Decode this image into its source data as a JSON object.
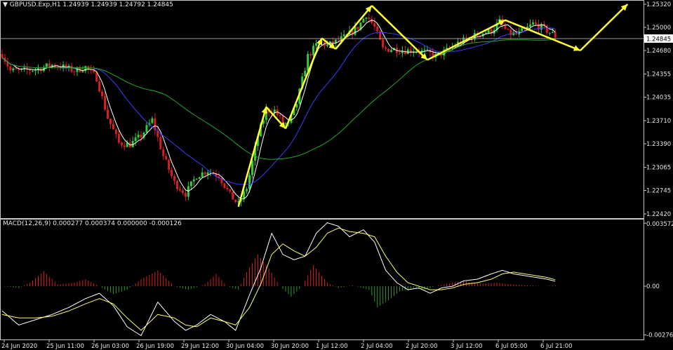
{
  "colors": {
    "background": "#000000",
    "bull_candle": "#2ecc40",
    "bear_candle": "#d62020",
    "ma_fast": "#ffffff",
    "ma_mid": "#3b3bff",
    "ma_slow": "#24a824",
    "arrows": "#ffff33",
    "macd_pos": "#d62020",
    "macd_neg": "#2a9a2a",
    "signal": "#ffff66",
    "grid_frame": "#c8c8c8"
  },
  "header": {
    "instrument": "GBPUSD.Exp,H1",
    "ohlc": "1.24939 1.24939 1.24792 1.24845"
  },
  "macd_header": {
    "label": "MACD(12,26,9) 0.000277 0.000374 0.000000 -0.000126"
  },
  "current_price_label": "1.24845",
  "chart_data": [
    {
      "type": "candlestick",
      "title": "GBPUSD.Exp,H1",
      "ylim": [
        1.2242,
        1.2532
      ],
      "y_ticks": [
        "1.25320",
        "1.25000",
        "1.24680",
        "1.24355",
        "1.24035",
        "1.23710",
        "1.23390",
        "1.23065",
        "1.22745",
        "1.22420"
      ],
      "current_price": 1.24845,
      "x_ticks": [
        "24 Jun 2020",
        "25 Jun 11:00",
        "26 Jun 03:00",
        "26 Jun 19:00",
        "29 Jun 12:00",
        "30 Jun 04:00",
        "30 Jun 20:00",
        "1 Jul 12:00",
        "2 Jul 04:00",
        "2 Jul 20:00",
        "3 Jul 12:00",
        "6 Jul 05:00",
        "6 Jul 21:00"
      ],
      "price_path_keypoints": [
        [
          0,
          1.2463
        ],
        [
          3,
          1.244
        ],
        [
          8,
          1.244
        ],
        [
          13,
          1.2443
        ],
        [
          18,
          1.2448
        ],
        [
          22,
          1.2445
        ],
        [
          26,
          1.244
        ],
        [
          30,
          1.2445
        ],
        [
          34,
          1.243
        ],
        [
          38,
          1.2375
        ],
        [
          42,
          1.234
        ],
        [
          46,
          1.2338
        ],
        [
          50,
          1.235
        ],
        [
          54,
          1.2372
        ],
        [
          58,
          1.2322
        ],
        [
          62,
          1.2285
        ],
        [
          66,
          1.227
        ],
        [
          70,
          1.2295
        ],
        [
          74,
          1.2302
        ],
        [
          78,
          1.2295
        ],
        [
          82,
          1.2268
        ],
        [
          85,
          1.2255
        ],
        [
          88,
          1.2278
        ],
        [
          92,
          1.235
        ],
        [
          95,
          1.2385
        ],
        [
          98,
          1.2385
        ],
        [
          101,
          1.2368
        ],
        [
          103,
          1.2365
        ],
        [
          106,
          1.2395
        ],
        [
          110,
          1.246
        ],
        [
          114,
          1.248
        ],
        [
          117,
          1.2475
        ],
        [
          120,
          1.248
        ],
        [
          124,
          1.2488
        ],
        [
          128,
          1.25
        ],
        [
          131,
          1.2518
        ],
        [
          134,
          1.25
        ],
        [
          137,
          1.247
        ],
        [
          141,
          1.247
        ],
        [
          145,
          1.2468
        ],
        [
          149,
          1.2468
        ],
        [
          153,
          1.2465
        ],
        [
          156,
          1.246
        ],
        [
          160,
          1.2468
        ],
        [
          164,
          1.2478
        ],
        [
          168,
          1.2485
        ],
        [
          172,
          1.2492
        ],
        [
          176,
          1.2495
        ],
        [
          179,
          1.2508
        ],
        [
          182,
          1.2492
        ],
        [
          185,
          1.249
        ],
        [
          188,
          1.2496
        ],
        [
          191,
          1.2505
        ],
        [
          194,
          1.25
        ],
        [
          197,
          1.2493
        ],
        [
          199,
          1.2488
        ]
      ],
      "zigzag_arrows": [
        [
          [
            85,
            1.2252
          ],
          [
            95,
            1.239
          ]
        ],
        [
          [
            95,
            1.239
          ],
          [
            102,
            1.236
          ]
        ],
        [
          [
            102,
            1.236
          ],
          [
            115,
            1.2485
          ]
        ],
        [
          [
            115,
            1.2485
          ],
          [
            120,
            1.247
          ]
        ],
        [
          [
            120,
            1.247
          ],
          [
            133,
            1.253
          ]
        ],
        [
          [
            133,
            1.253
          ],
          [
            153,
            1.2455
          ]
        ],
        [
          [
            153,
            1.2455
          ],
          [
            181,
            1.251
          ]
        ],
        [
          [
            181,
            1.251
          ],
          [
            208,
            1.2468
          ]
        ],
        [
          [
            208,
            1.2468
          ],
          [
            225,
            1.2532
          ]
        ]
      ]
    },
    {
      "type": "histogram",
      "title": "MACD(12,26,9) 0.000277 0.000374 0.000000 -0.000126",
      "ylim": [
        -0.00278,
        0.00358
      ],
      "y_ticks": [
        "0.003572",
        "0.00",
        "-0.002763"
      ],
      "histogram_keypoints": [
        [
          0,
          0.0
        ],
        [
          6,
          -0.0001
        ],
        [
          10,
          0.0002
        ],
        [
          15,
          0.00085
        ],
        [
          20,
          0.0001
        ],
        [
          26,
          0.0002
        ],
        [
          30,
          0.0004
        ],
        [
          35,
          0.0
        ],
        [
          40,
          -0.00045
        ],
        [
          45,
          -0.0002
        ],
        [
          50,
          0.0004
        ],
        [
          56,
          0.0009
        ],
        [
          62,
          0.0
        ],
        [
          67,
          -0.0002
        ],
        [
          73,
          0.0001
        ],
        [
          77,
          0.0007
        ],
        [
          81,
          0.0
        ],
        [
          85,
          -0.0002
        ],
        [
          88,
          0.0008
        ],
        [
          92,
          0.0018
        ],
        [
          96,
          0.001
        ],
        [
          100,
          0.0
        ],
        [
          104,
          -0.0006
        ],
        [
          108,
          0.0
        ],
        [
          112,
          0.0012
        ],
        [
          117,
          0.0002
        ],
        [
          121,
          -0.0001
        ],
        [
          126,
          5e-05
        ],
        [
          132,
          -0.0002
        ],
        [
          135,
          -0.0012
        ],
        [
          139,
          -0.0008
        ],
        [
          143,
          -0.0003
        ],
        [
          148,
          -0.0001
        ],
        [
          152,
          -0.0002
        ],
        [
          156,
          0.0
        ],
        [
          160,
          0.00015
        ],
        [
          166,
          0.0003
        ],
        [
          172,
          0.00015
        ],
        [
          178,
          0.0002
        ],
        [
          184,
          0.0001
        ],
        [
          190,
          5e-05
        ],
        [
          195,
          0.0
        ],
        [
          199,
          5e-05
        ]
      ],
      "macd_keypoints": [
        [
          0,
          -0.0014
        ],
        [
          6,
          -0.0022
        ],
        [
          12,
          -0.0019
        ],
        [
          18,
          -0.0016
        ],
        [
          24,
          -0.0012
        ],
        [
          30,
          -0.0007
        ],
        [
          35,
          -0.0004
        ],
        [
          40,
          -0.0011
        ],
        [
          45,
          -0.0023
        ],
        [
          50,
          -0.0028
        ],
        [
          56,
          -0.0009
        ],
        [
          62,
          -0.002
        ],
        [
          66,
          -0.0025
        ],
        [
          70,
          -0.0022
        ],
        [
          75,
          -0.0016
        ],
        [
          80,
          -0.002
        ],
        [
          84,
          -0.0025
        ],
        [
          89,
          -0.0005
        ],
        [
          93,
          0.001
        ],
        [
          97,
          0.003
        ],
        [
          101,
          0.0018
        ],
        [
          105,
          0.0015
        ],
        [
          109,
          0.0017
        ],
        [
          113,
          0.003
        ],
        [
          117,
          0.0036
        ],
        [
          121,
          0.0034
        ],
        [
          125,
          0.0028
        ],
        [
          130,
          0.0032
        ],
        [
          134,
          0.0025
        ],
        [
          138,
          0.0009
        ],
        [
          142,
          0.0002
        ],
        [
          146,
          -0.0002
        ],
        [
          150,
          -0.0001
        ],
        [
          154,
          -0.0004
        ],
        [
          158,
          -0.0001
        ],
        [
          162,
          0.0
        ],
        [
          166,
          0.0003
        ],
        [
          171,
          0.0004
        ],
        [
          176,
          0.0007
        ],
        [
          180,
          0.0009
        ],
        [
          184,
          0.0007
        ],
        [
          188,
          0.0006
        ],
        [
          192,
          0.0005
        ],
        [
          196,
          0.0004
        ],
        [
          199,
          0.00028
        ]
      ],
      "signal_keypoints": [
        [
          0,
          -0.0016
        ],
        [
          6,
          -0.0018
        ],
        [
          12,
          -0.0018
        ],
        [
          18,
          -0.0017
        ],
        [
          24,
          -0.0014
        ],
        [
          30,
          -0.001
        ],
        [
          35,
          -0.0007
        ],
        [
          40,
          -0.001
        ],
        [
          45,
          -0.0018
        ],
        [
          50,
          -0.0025
        ],
        [
          56,
          -0.0016
        ],
        [
          62,
          -0.0018
        ],
        [
          66,
          -0.0022
        ],
        [
          70,
          -0.0023
        ],
        [
          75,
          -0.0018
        ],
        [
          80,
          -0.002
        ],
        [
          84,
          -0.0022
        ],
        [
          89,
          -0.0012
        ],
        [
          93,
          0.0001
        ],
        [
          97,
          0.0018
        ],
        [
          101,
          0.0024
        ],
        [
          105,
          0.002
        ],
        [
          109,
          0.0017
        ],
        [
          113,
          0.0022
        ],
        [
          117,
          0.003
        ],
        [
          121,
          0.0033
        ],
        [
          125,
          0.0031
        ],
        [
          130,
          0.003
        ],
        [
          134,
          0.0028
        ],
        [
          138,
          0.0017
        ],
        [
          142,
          0.0008
        ],
        [
          146,
          0.0002
        ],
        [
          150,
          0.0
        ],
        [
          154,
          -0.0002
        ],
        [
          158,
          -0.0002
        ],
        [
          162,
          -0.0001
        ],
        [
          166,
          0.0001
        ],
        [
          171,
          0.0002
        ],
        [
          176,
          0.0004
        ],
        [
          180,
          0.0007
        ],
        [
          184,
          0.0008
        ],
        [
          188,
          0.0007
        ],
        [
          192,
          0.0006
        ],
        [
          196,
          0.0005
        ],
        [
          199,
          0.00037
        ]
      ]
    }
  ]
}
